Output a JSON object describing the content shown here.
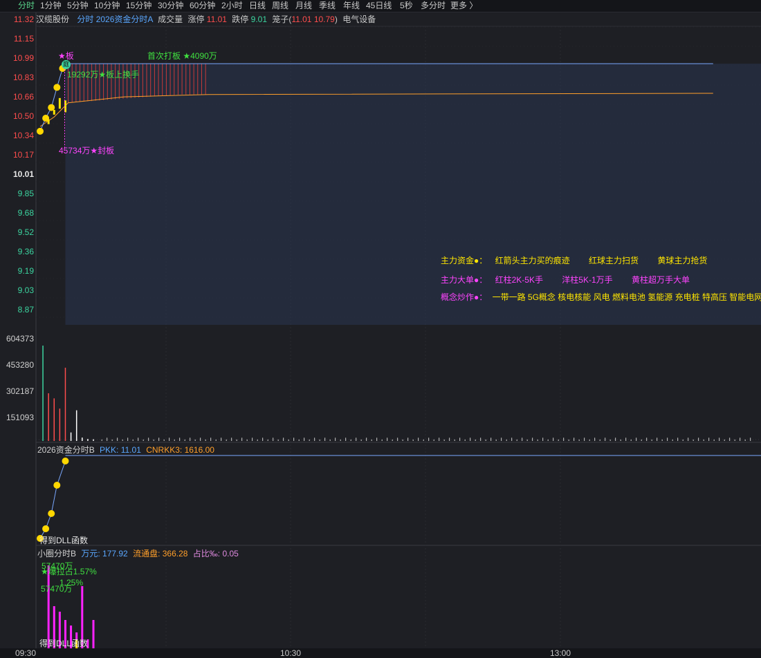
{
  "tabs": [
    "分时",
    "1分钟",
    "5分钟",
    "10分钟",
    "15分钟",
    "30分钟",
    "60分钟",
    "2小时",
    "日线",
    "周线",
    "月线",
    "季线",
    "年线",
    "45日线",
    "5秒",
    "多分时",
    "更多 〉"
  ],
  "info": {
    "stock_name": "汉缆股份",
    "indicator": "分时 2026资金分时A",
    "volume_label": "成交量",
    "limit_up_label": "涨停",
    "limit_up_value": "11.01",
    "limit_down_label": "跌停",
    "limit_down_value": "9.01",
    "basket_label": "笼子(",
    "basket_values": "11.01 10.79",
    "basket_close": ")",
    "sector": "电气设备"
  },
  "price_axis": {
    "ticks": [
      "11.32",
      "11.15",
      "10.99",
      "10.83",
      "10.66",
      "10.50",
      "10.34",
      "10.17",
      "10.01",
      "9.85",
      "9.68",
      "9.52",
      "9.36",
      "9.19",
      "9.03",
      "8.87"
    ],
    "prev_close": "10.01"
  },
  "volume_axis": {
    "ticks": [
      "604373",
      "453280",
      "302187",
      "151093"
    ]
  },
  "time_axis": {
    "ticks": [
      "09:30",
      "10:30",
      "13:00"
    ]
  },
  "annotations": {
    "star_board": "★板",
    "ting_badge": "庭",
    "first_board": "首次打板 ★4090万",
    "turnover": "19292万★板上换手",
    "seal": "45734万★封板"
  },
  "legend": {
    "row1_label": "主力资金●：",
    "row1_items": [
      "红箭头主力买的痕迹",
      "红球主力扫货",
      "黄球主力抢货"
    ],
    "row2_label": "主力大单●：",
    "row2_items": [
      "红柱2K-5K手",
      "洋柱5K-1万手",
      "黄柱超万手大单"
    ],
    "row3_label": "概念炒作●：",
    "row3_text": "一带一路 5G概念 核电核能 风电 燃料电池 氢能源 充电桩 特高压 智能电网"
  },
  "panel2": {
    "title": "2026资金分时B",
    "pkk": "PKK: 11.01",
    "cnrkk3": "CNRKK3: 1616.00",
    "footer": "得到DLL函数"
  },
  "panel3": {
    "title": "小圈分时B",
    "wan": "万元: 177.92",
    "float": "流通盘: 366.28",
    "ratio": "占比‰: 0.05",
    "label1": "57470万",
    "label2": "★爆拉占1.57%",
    "label3": "57470万",
    "label4": "1.25%",
    "footer": "得到DLL函数"
  },
  "chart_data": {
    "type": "line",
    "price_points": [
      {
        "t": 0,
        "price": 10.44
      },
      {
        "t": 2,
        "price": 10.55
      },
      {
        "t": 4,
        "price": 10.64
      },
      {
        "t": 6,
        "price": 10.81
      },
      {
        "t": 8,
        "price": 10.97
      },
      {
        "t": 9,
        "price": 11.01
      },
      {
        "t": 240,
        "price": 11.01
      }
    ],
    "avg_points": [
      {
        "t": 0,
        "price": 10.48
      },
      {
        "t": 5,
        "price": 10.56
      },
      {
        "t": 10,
        "price": 10.68
      },
      {
        "t": 30,
        "price": 10.73
      },
      {
        "t": 60,
        "price": 10.75
      },
      {
        "t": 240,
        "price": 10.76
      }
    ],
    "volume_ticks": [
      "604373",
      "453280",
      "302187",
      "151093"
    ],
    "volume_bars": [
      {
        "t": 1,
        "v": 560000,
        "color": "#3cd5a0"
      },
      {
        "t": 3,
        "v": 280000,
        "color": "#ff4d4d"
      },
      {
        "t": 5,
        "v": 250000,
        "color": "#ff4d4d"
      },
      {
        "t": 7,
        "v": 190000,
        "color": "#ff4d4d"
      },
      {
        "t": 9,
        "v": 430000,
        "color": "#ff4d4d"
      },
      {
        "t": 11,
        "v": 50000,
        "color": "#ffffff"
      },
      {
        "t": 13,
        "v": 180000,
        "color": "#ffffff"
      },
      {
        "t": 15,
        "v": 20000,
        "color": "#ffffff"
      },
      {
        "t": 17,
        "v": 12000,
        "color": "#ffffff"
      },
      {
        "t": 19,
        "v": 10000,
        "color": "#ffffff"
      }
    ]
  }
}
